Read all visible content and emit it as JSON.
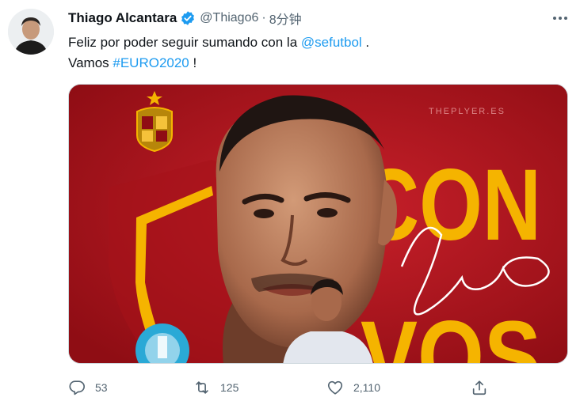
{
  "author": {
    "display_name": "Thiago Alcantara",
    "handle": "@Thiago6",
    "verified": true,
    "separator": "·",
    "time": "8分钟"
  },
  "tweet": {
    "line1_text": "Feliz por poder seguir sumando con la ",
    "mention": "@sefutbol",
    "line1_end": " .",
    "line2_text": "Vamos ",
    "hashtag": "#EURO2020",
    "line2_end": " !"
  },
  "media": {
    "watermark": "THEPLYER.ES",
    "headline_words": [
      "CON",
      "VOS"
    ],
    "colors": {
      "background": "#b5141c",
      "accent": "#f5b400"
    }
  },
  "actions": {
    "replies": "53",
    "retweets": "125",
    "likes": "2,110"
  },
  "colors": {
    "link": "#1d9bf0",
    "muted": "#536471",
    "text": "#0f1419"
  }
}
